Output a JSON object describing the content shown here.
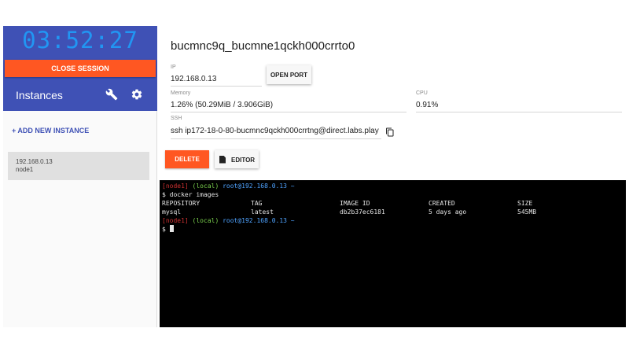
{
  "sidebar": {
    "timer": "03:52:27",
    "close_session_label": "CLOSE SESSION",
    "title": "Instances",
    "add_instance_label": "+ ADD NEW INSTANCE",
    "instances": [
      {
        "ip": "192.168.0.13",
        "name": "node1"
      }
    ]
  },
  "instance": {
    "hostname": "bucmnc9q_bucmne1qckh000crrto0",
    "ip_label": "IP",
    "ip_value": "192.168.0.13",
    "open_port_label": "OPEN PORT",
    "memory_label": "Memory",
    "memory_value": "1.26% (50.29MiB / 3.906GiB)",
    "cpu_label": "CPU",
    "cpu_value": "0.91%",
    "ssh_label": "SSH",
    "ssh_value": "ssh ip172-18-0-80-bucmnc9qckh000crrtng@direct.labs.play",
    "delete_label": "DELETE",
    "editor_label": "EDITOR"
  },
  "terminal": {
    "prompt_node": "[node1]",
    "prompt_local": "(local)",
    "prompt_user": "root@192.168.0.13 ~",
    "command": "$ docker images",
    "headers": [
      "REPOSITORY",
      "TAG",
      "IMAGE ID",
      "CREATED",
      "SIZE"
    ],
    "rows": [
      [
        "mysql",
        "latest",
        "db2b37ec6181",
        "5 days ago",
        "545MB"
      ]
    ],
    "prompt_node_2": "[node1]",
    "prompt_local_2": "(local)",
    "prompt_user_2": "root@192.168.0.13 ~",
    "current_prompt": "$"
  },
  "colors": {
    "sidebar_header": "#3f51b5",
    "timer": "#2196f3",
    "accent_orange": "#ff5722",
    "terminal_bg": "#000000"
  },
  "icons": {
    "wrench": "wrench-icon",
    "gear": "gear-icon",
    "copy": "copy-icon",
    "editor": "document-icon"
  }
}
